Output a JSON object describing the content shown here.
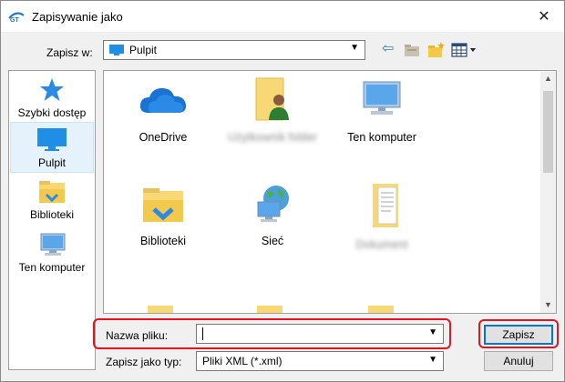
{
  "window": {
    "title": "Zapisywanie jako",
    "close_glyph": "✕"
  },
  "toolbar": {
    "save_in_label": "Zapisz w:",
    "save_in_value": "Pulpit",
    "dropdown_glyph": "▼",
    "back_glyph": "⇦"
  },
  "places": [
    {
      "label": "Szybki dostęp",
      "icon": "star-icon"
    },
    {
      "label": "Pulpit",
      "icon": "desktop-icon",
      "selected": true
    },
    {
      "label": "Biblioteki",
      "icon": "libraries-icon"
    },
    {
      "label": "Ten komputer",
      "icon": "computer-icon"
    }
  ],
  "files": [
    {
      "label": "OneDrive",
      "icon": "onedrive-icon"
    },
    {
      "label": "",
      "icon": "user-folder-icon",
      "redacted": true
    },
    {
      "label": "Ten komputer",
      "icon": "computer-icon"
    },
    {
      "label": "Biblioteki",
      "icon": "libraries-icon"
    },
    {
      "label": "Sieć",
      "icon": "network-icon"
    },
    {
      "label": "",
      "icon": "document-folder-icon",
      "redacted": true
    }
  ],
  "form": {
    "filename_label": "Nazwa pliku:",
    "filename_value": "",
    "filetype_label": "Zapisz jako typ:",
    "filetype_value": "Pliki XML (*.xml)"
  },
  "buttons": {
    "save": "Zapisz",
    "cancel": "Anuluj"
  },
  "colors": {
    "accent": "#0078d7",
    "highlight": "#e5141f",
    "folder": "#f8d775"
  }
}
